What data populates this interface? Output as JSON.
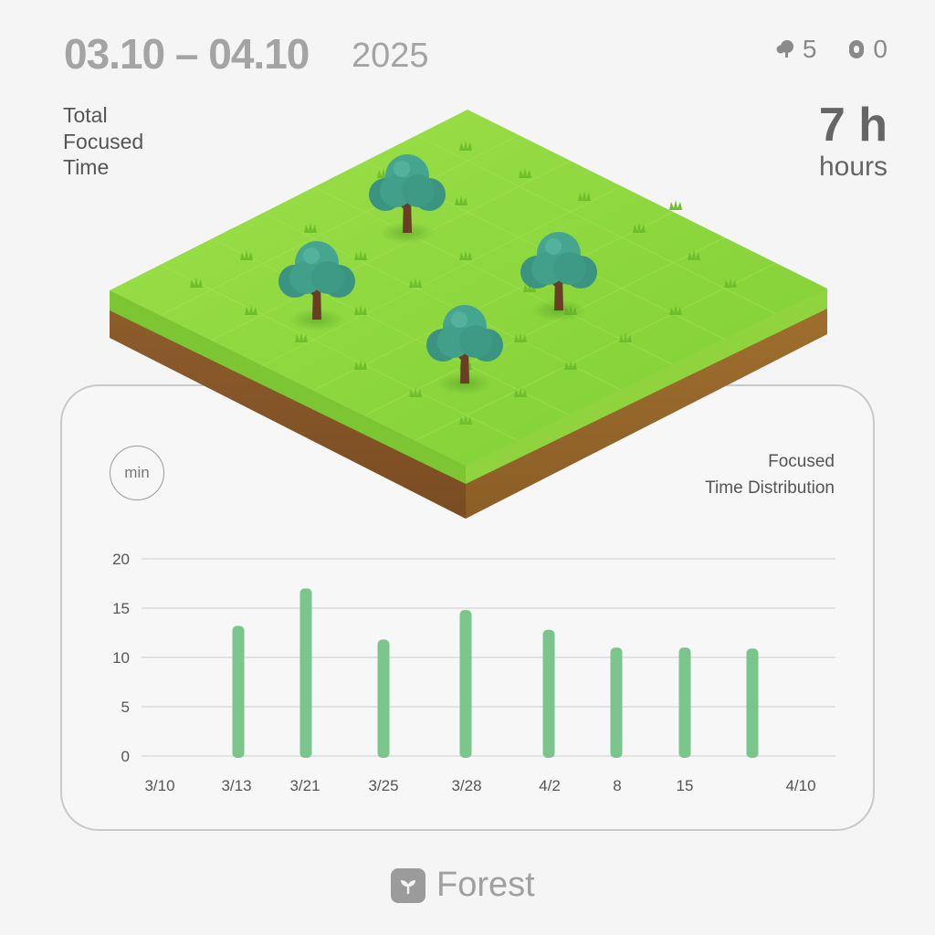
{
  "header": {
    "date_range": "03.10 – 04.10",
    "year": "2025",
    "counters": {
      "trees": "5",
      "dead": "0"
    }
  },
  "summary": {
    "label_lines": [
      "Total",
      "Focused",
      "Time"
    ],
    "value": "7 h",
    "unit": "hours"
  },
  "chart": {
    "unit_badge": "min",
    "title_lines": [
      "Focused",
      "Time Distribution"
    ]
  },
  "chart_data": {
    "type": "bar",
    "title": "Focused Time Distribution",
    "ylabel": "min",
    "ylim": [
      0,
      20
    ],
    "yticks": [
      0,
      5,
      10,
      15,
      20
    ],
    "x_tick_labels": [
      "3/10",
      "3/13",
      "3/21",
      "3/25",
      "3/28",
      "4/2",
      "8",
      "15",
      "4/10"
    ],
    "bars": [
      {
        "label": "3/13",
        "value": 13.2
      },
      {
        "label": "3/21",
        "value": 17
      },
      {
        "label": "3/25",
        "value": 11.8
      },
      {
        "label": "3/28",
        "value": 14.8
      },
      {
        "label": "4/2",
        "value": 12.8
      },
      {
        "label": "8",
        "value": 11
      },
      {
        "label": "15",
        "value": 11
      },
      {
        "label": "",
        "value": 10.9
      }
    ],
    "bar_color": "#79c58c",
    "grid": true
  },
  "brand": {
    "name": "Forest"
  },
  "colors": {
    "grass": "#8bd53a",
    "soil": "#8a5a2b",
    "tree": "#3e9c86",
    "trunk": "#6a3e25"
  }
}
